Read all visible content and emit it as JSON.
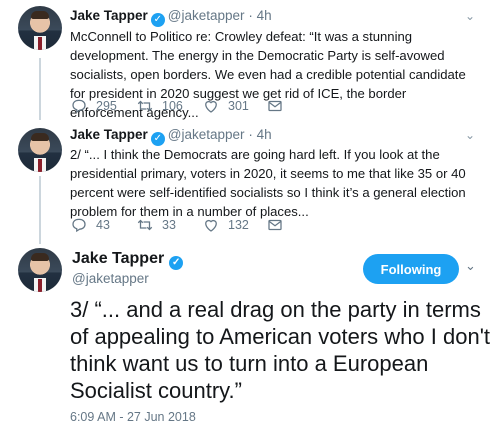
{
  "tweets": [
    {
      "name": "Jake Tapper",
      "handle": "@jaketapper",
      "separator": "·",
      "time": "4h",
      "text": "McConnell to Politico re: Crowley defeat: “It was a stunning development.  The energy in the Democratic Party is self-avowed socialists, open borders.  We even had a credible potential candidate for president in 2020 suggest we get rid of ICE, the border enforcement agency...",
      "replies": "295",
      "retweets": "106",
      "likes": "301"
    },
    {
      "name": "Jake Tapper",
      "handle": "@jaketapper",
      "separator": "·",
      "time": "4h",
      "text": "2/ “... I think the Democrats are going hard left.  If you look at the presidential primary, voters in 2020, it seems to me that like 35 or 40 percent were self-identified socialists so I think it’s a general election problem for them in a number of places...",
      "replies": "43",
      "retweets": "33",
      "likes": "132"
    }
  ],
  "main_tweet": {
    "name": "Jake Tapper",
    "handle": "@jaketapper",
    "follow_label": "Following",
    "text": "3/ “... and a real drag on the party in terms of appealing to American voters who I don't think want us to turn into a European Socialist country.”",
    "timestamp": "6:09 AM - 27 Jun 2018"
  },
  "colors": {
    "accent": "#1da1f2",
    "muted": "#657786",
    "text": "#14171a"
  },
  "icons": [
    "verified-badge-icon",
    "chevron-down-icon",
    "reply-icon",
    "retweet-icon",
    "like-icon",
    "direct-message-icon"
  ]
}
